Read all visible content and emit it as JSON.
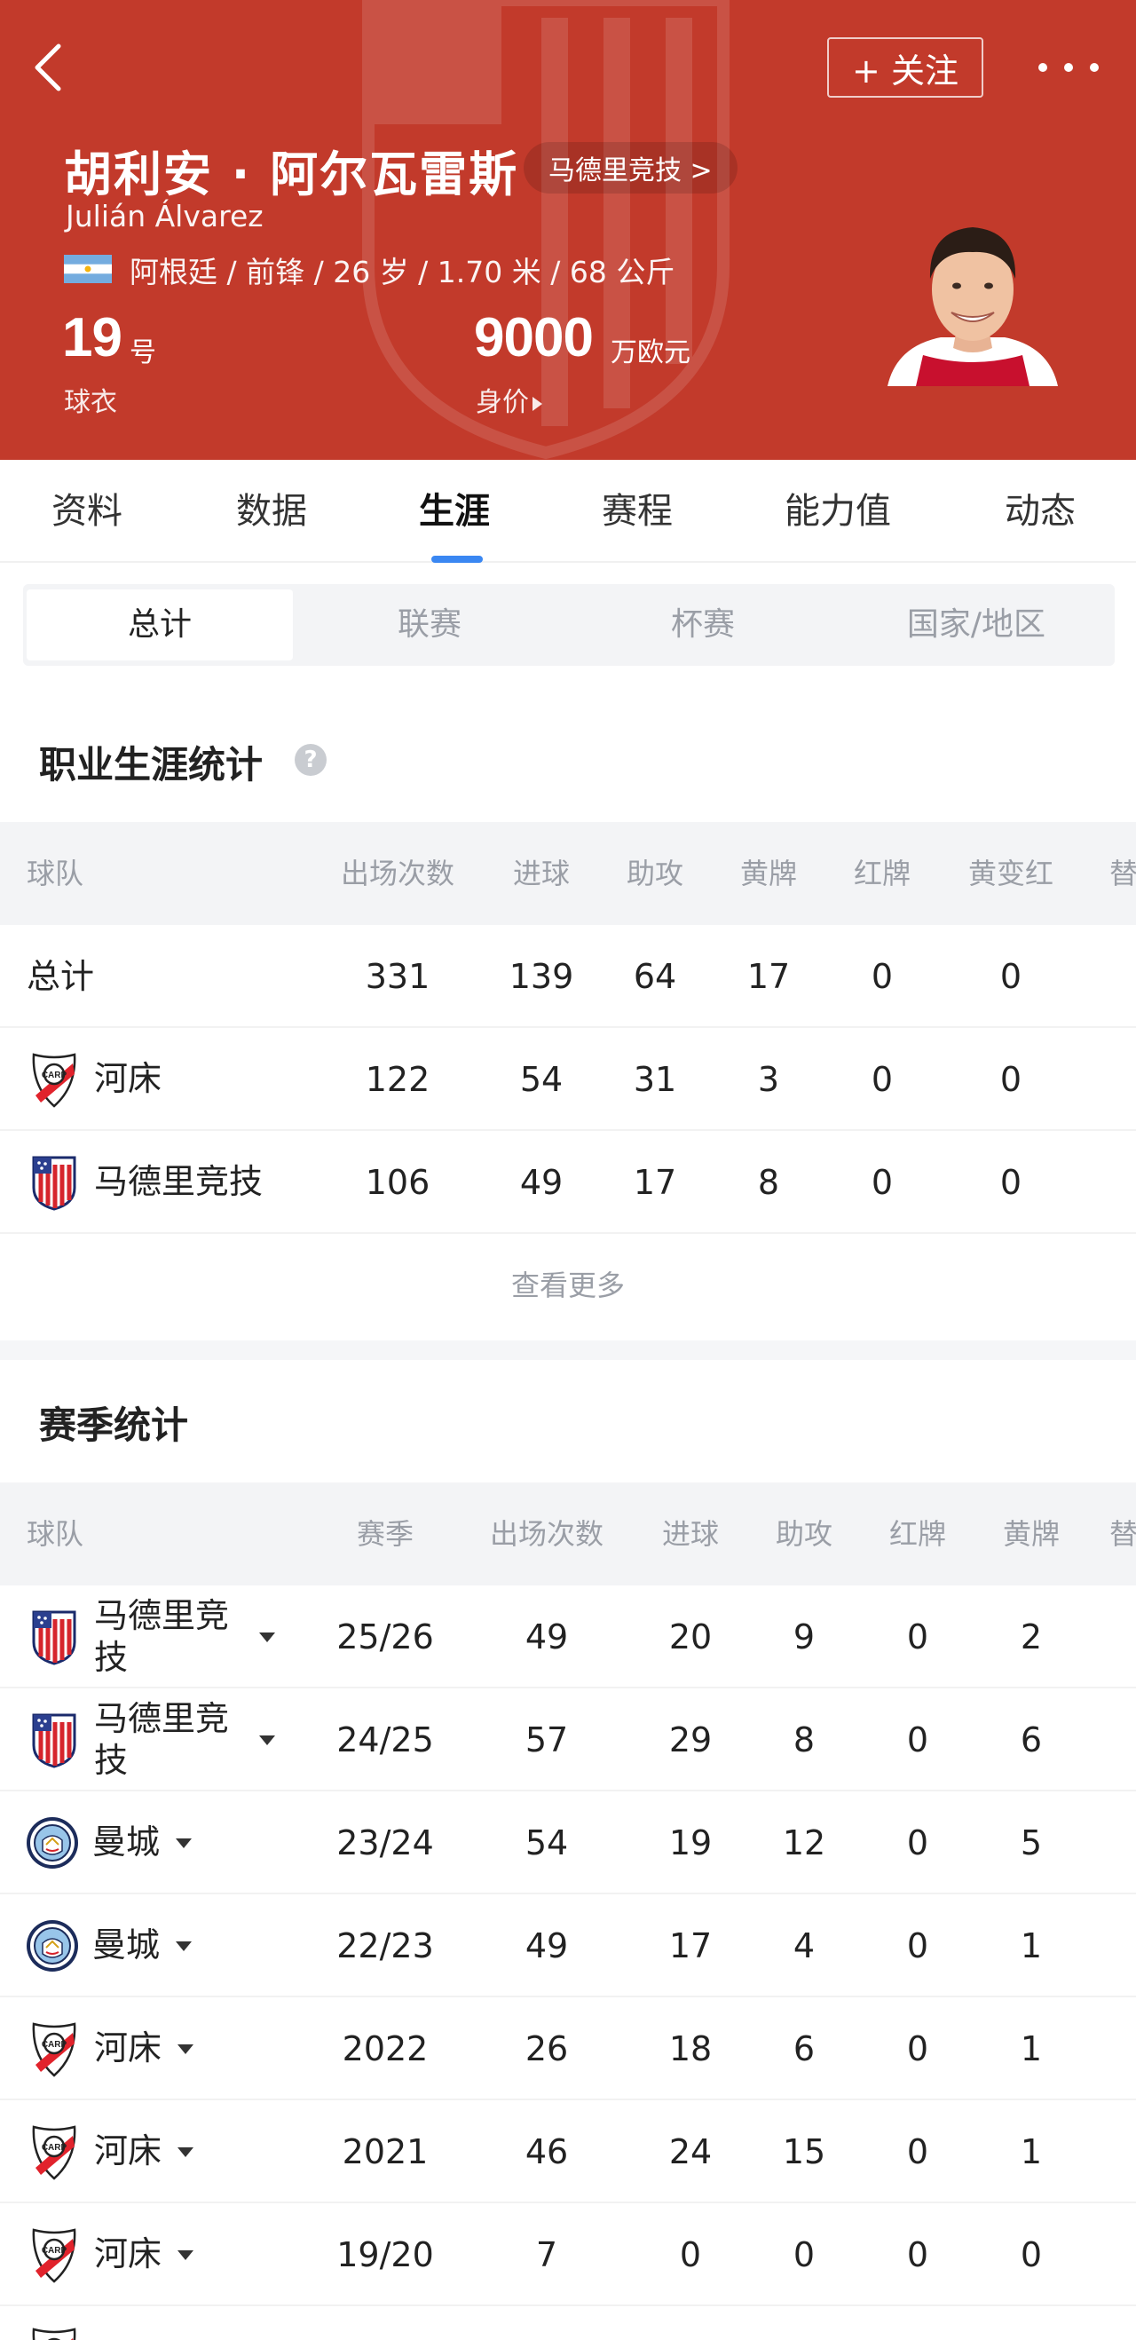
{
  "header": {
    "follow_label": "+ 关注",
    "player_name": "胡利安 · 阿尔瓦雷斯",
    "club_chip": "马德里竞技 >",
    "latin_name": "Julián Álvarez",
    "bio": "阿根廷 / 前锋 / 26 岁 / 1.70 米 / 68 公斤",
    "shirt_number": "19",
    "shirt_unit": "号",
    "shirt_label": "球衣",
    "market_value": "9000",
    "market_value_unit": "万欧元",
    "market_value_label": "身价",
    "colors": {
      "background": "#c23a2b",
      "tab_accent": "#3a87f2"
    }
  },
  "main_tabs": [
    "资料",
    "数据",
    "生涯",
    "赛程",
    "能力值",
    "动态"
  ],
  "active_main_tab": "生涯",
  "sub_tabs": [
    "总计",
    "联赛",
    "杯赛",
    "国家/地区"
  ],
  "active_sub_tab": "总计",
  "career": {
    "title": "职业生涯统计",
    "help_icon": "?",
    "columns": [
      "球队",
      "出场次数",
      "进球",
      "助攻",
      "黄牌",
      "红牌",
      "黄变红",
      "替"
    ],
    "rows": [
      {
        "team": "总计",
        "badge": "",
        "apps": "331",
        "goals": "139",
        "assists": "64",
        "yellow": "17",
        "red": "0",
        "yellow_red": "0"
      },
      {
        "team": "河床",
        "badge": "river-plate-badge-icon",
        "apps": "122",
        "goals": "54",
        "assists": "31",
        "yellow": "3",
        "red": "0",
        "yellow_red": "0"
      },
      {
        "team": "马德里竞技",
        "badge": "atletico-madrid-badge-icon",
        "apps": "106",
        "goals": "49",
        "assists": "17",
        "yellow": "8",
        "red": "0",
        "yellow_red": "0"
      }
    ],
    "see_more": "查看更多"
  },
  "season": {
    "title": "赛季统计",
    "columns": [
      "球队",
      "赛季",
      "出场次数",
      "进球",
      "助攻",
      "红牌",
      "黄牌",
      "替"
    ],
    "rows": [
      {
        "team": "马德里竞技",
        "badge": "atletico-madrid-badge-icon",
        "season": "25/26",
        "apps": "49",
        "goals": "20",
        "assists": "9",
        "red": "0",
        "yellow": "2"
      },
      {
        "team": "马德里竞技",
        "badge": "atletico-madrid-badge-icon",
        "season": "24/25",
        "apps": "57",
        "goals": "29",
        "assists": "8",
        "red": "0",
        "yellow": "6"
      },
      {
        "team": "曼城",
        "badge": "manchester-city-badge-icon",
        "season": "23/24",
        "apps": "54",
        "goals": "19",
        "assists": "12",
        "red": "0",
        "yellow": "5"
      },
      {
        "team": "曼城",
        "badge": "manchester-city-badge-icon",
        "season": "22/23",
        "apps": "49",
        "goals": "17",
        "assists": "4",
        "red": "0",
        "yellow": "1"
      },
      {
        "team": "河床",
        "badge": "river-plate-badge-icon",
        "season": "2022",
        "apps": "26",
        "goals": "18",
        "assists": "6",
        "red": "0",
        "yellow": "1"
      },
      {
        "team": "河床",
        "badge": "river-plate-badge-icon",
        "season": "2021",
        "apps": "46",
        "goals": "24",
        "assists": "15",
        "red": "0",
        "yellow": "1"
      },
      {
        "team": "河床",
        "badge": "river-plate-badge-icon",
        "season": "19/20",
        "apps": "7",
        "goals": "0",
        "assists": "0",
        "red": "0",
        "yellow": "0"
      }
    ]
  }
}
